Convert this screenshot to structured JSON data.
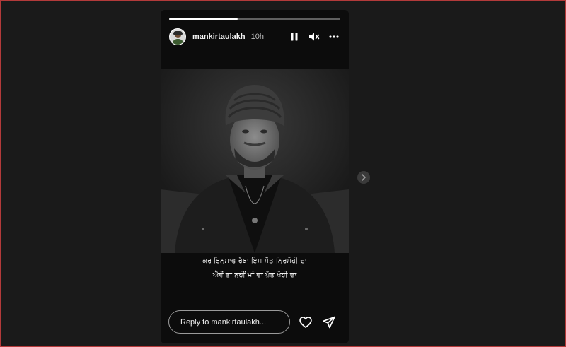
{
  "story": {
    "progress_fraction": 0.4,
    "user": {
      "username": "mankirtaulakh",
      "time_ago": "10h"
    },
    "controls": {
      "pause_icon": "pause-icon",
      "mute_icon": "muted-speaker-icon",
      "more_icon": "more-horizontal-icon"
    },
    "caption": {
      "line1": "ਕਰ ਇਨਸਾਫ ਰੱਬਾ ਇਸ ਮੌਤ ਨਿਰਮੋਹੀ ਦਾ",
      "line2": "ਐਵੇਂ ਤਾ ਨਹੀਂ ਮਾਂ ਦਾ ਪੁੱਤ ਖੋਹੀ ਦਾ"
    },
    "reply_placeholder": "Reply to mankirtaulakh...",
    "actions": {
      "like_icon": "heart-icon",
      "share_icon": "paper-plane-icon"
    }
  },
  "navigation": {
    "next_icon": "chevron-right-icon"
  },
  "colors": {
    "background": "#1a1a1a",
    "story_background": "#0c0c0c",
    "border": "#b33a3a",
    "text": "#f5f5f5"
  }
}
